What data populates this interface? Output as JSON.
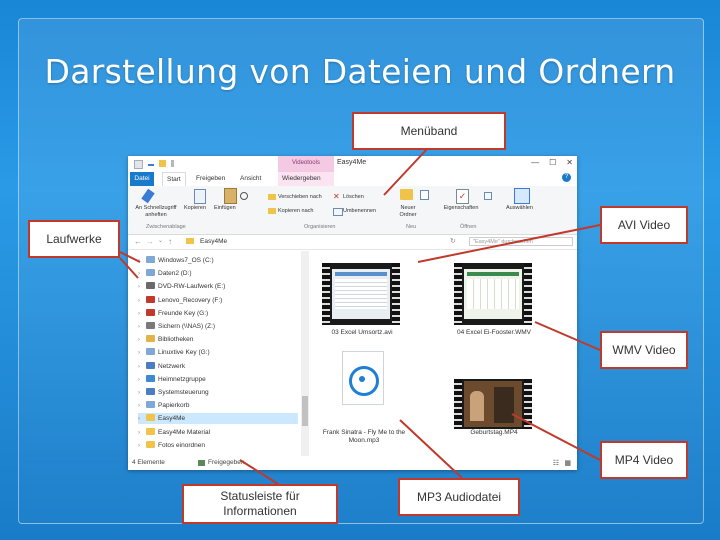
{
  "slide": {
    "title": "Darstellung von Dateien und Ordnern"
  },
  "callouts": {
    "menueband": "Menüband",
    "laufwerke": "Laufwerke",
    "avi": "AVI Video",
    "wmv": "WMV Video",
    "mp4": "MP4 Video",
    "statusleiste": "Statusleiste für Informationen",
    "mp3": "MP3 Audiodatei"
  },
  "explorer": {
    "window_title": "Easy4Me",
    "context_tab": "Videotools",
    "tabs": {
      "datei": "Datei",
      "start": "Start",
      "freigeben": "Freigeben",
      "ansicht": "Ansicht",
      "wiedergeben": "Wiedergeben"
    },
    "ribbon": {
      "anheften": "An Schnellzugriff anheften",
      "kopieren": "Kopieren",
      "einfuegen": "Einfügen",
      "verschieben": "Verschieben nach",
      "kopieren_nach": "Kopieren nach",
      "loeschen": "Löschen",
      "umbenennen": "Umbenennen",
      "neuer_ordner": "Neuer Ordner",
      "eigenschaften": "Eigenschaften",
      "auswaehlen": "Auswählen",
      "group_zwischenablage": "Zwischenablage",
      "group_organisieren": "Organisieren",
      "group_neu": "Neu",
      "group_oeffnen": "Öffnen"
    },
    "address": "Easy4Me",
    "search_placeholder": "\"Easy4Me\" durchsuchen",
    "nav": [
      {
        "label": "Windows7_OS (C:)",
        "color": "#7fa8d6"
      },
      {
        "label": "Daten2 (D:)",
        "color": "#7fa8d6"
      },
      {
        "label": "DVD-RW-Laufwerk (E:)",
        "color": "#6a6a6a"
      },
      {
        "label": "Lenovo_Recovery (F:)",
        "color": "#c0392b"
      },
      {
        "label": "Freunde Key (G:)",
        "color": "#c0392b"
      },
      {
        "label": "Sichern (\\\\NAS) (Z:)",
        "color": "#7a7a7a"
      },
      {
        "label": "Bibliotheken",
        "color": "#e3b44a"
      },
      {
        "label": "Linuxtive Key (G:)",
        "color": "#7fa8d6"
      },
      {
        "label": "Netzwerk",
        "color": "#4a7ec2"
      },
      {
        "label": "Heimnetzgruppe",
        "color": "#3a8ad4"
      },
      {
        "label": "Systemsteuerung",
        "color": "#4a7ec2"
      },
      {
        "label": "Papierkorb",
        "color": "#7fa8d6"
      },
      {
        "label": "Easy4Me",
        "color": "#f0c34a"
      },
      {
        "label": "Easy4Me Material",
        "color": "#f0c34a"
      },
      {
        "label": "Fotos einordnen",
        "color": "#f0c34a"
      }
    ],
    "files": {
      "avi": "03 Excel Umsortz.avi",
      "wmv": "04 Excel Ei-Fooster.WMV",
      "mp3": "Frank Sinatra - Fly Me to the Moon.mp3",
      "mp4": "Geburtstag.MP4"
    },
    "status": {
      "count": "4 Elemente",
      "state": "Freigegeben"
    }
  }
}
